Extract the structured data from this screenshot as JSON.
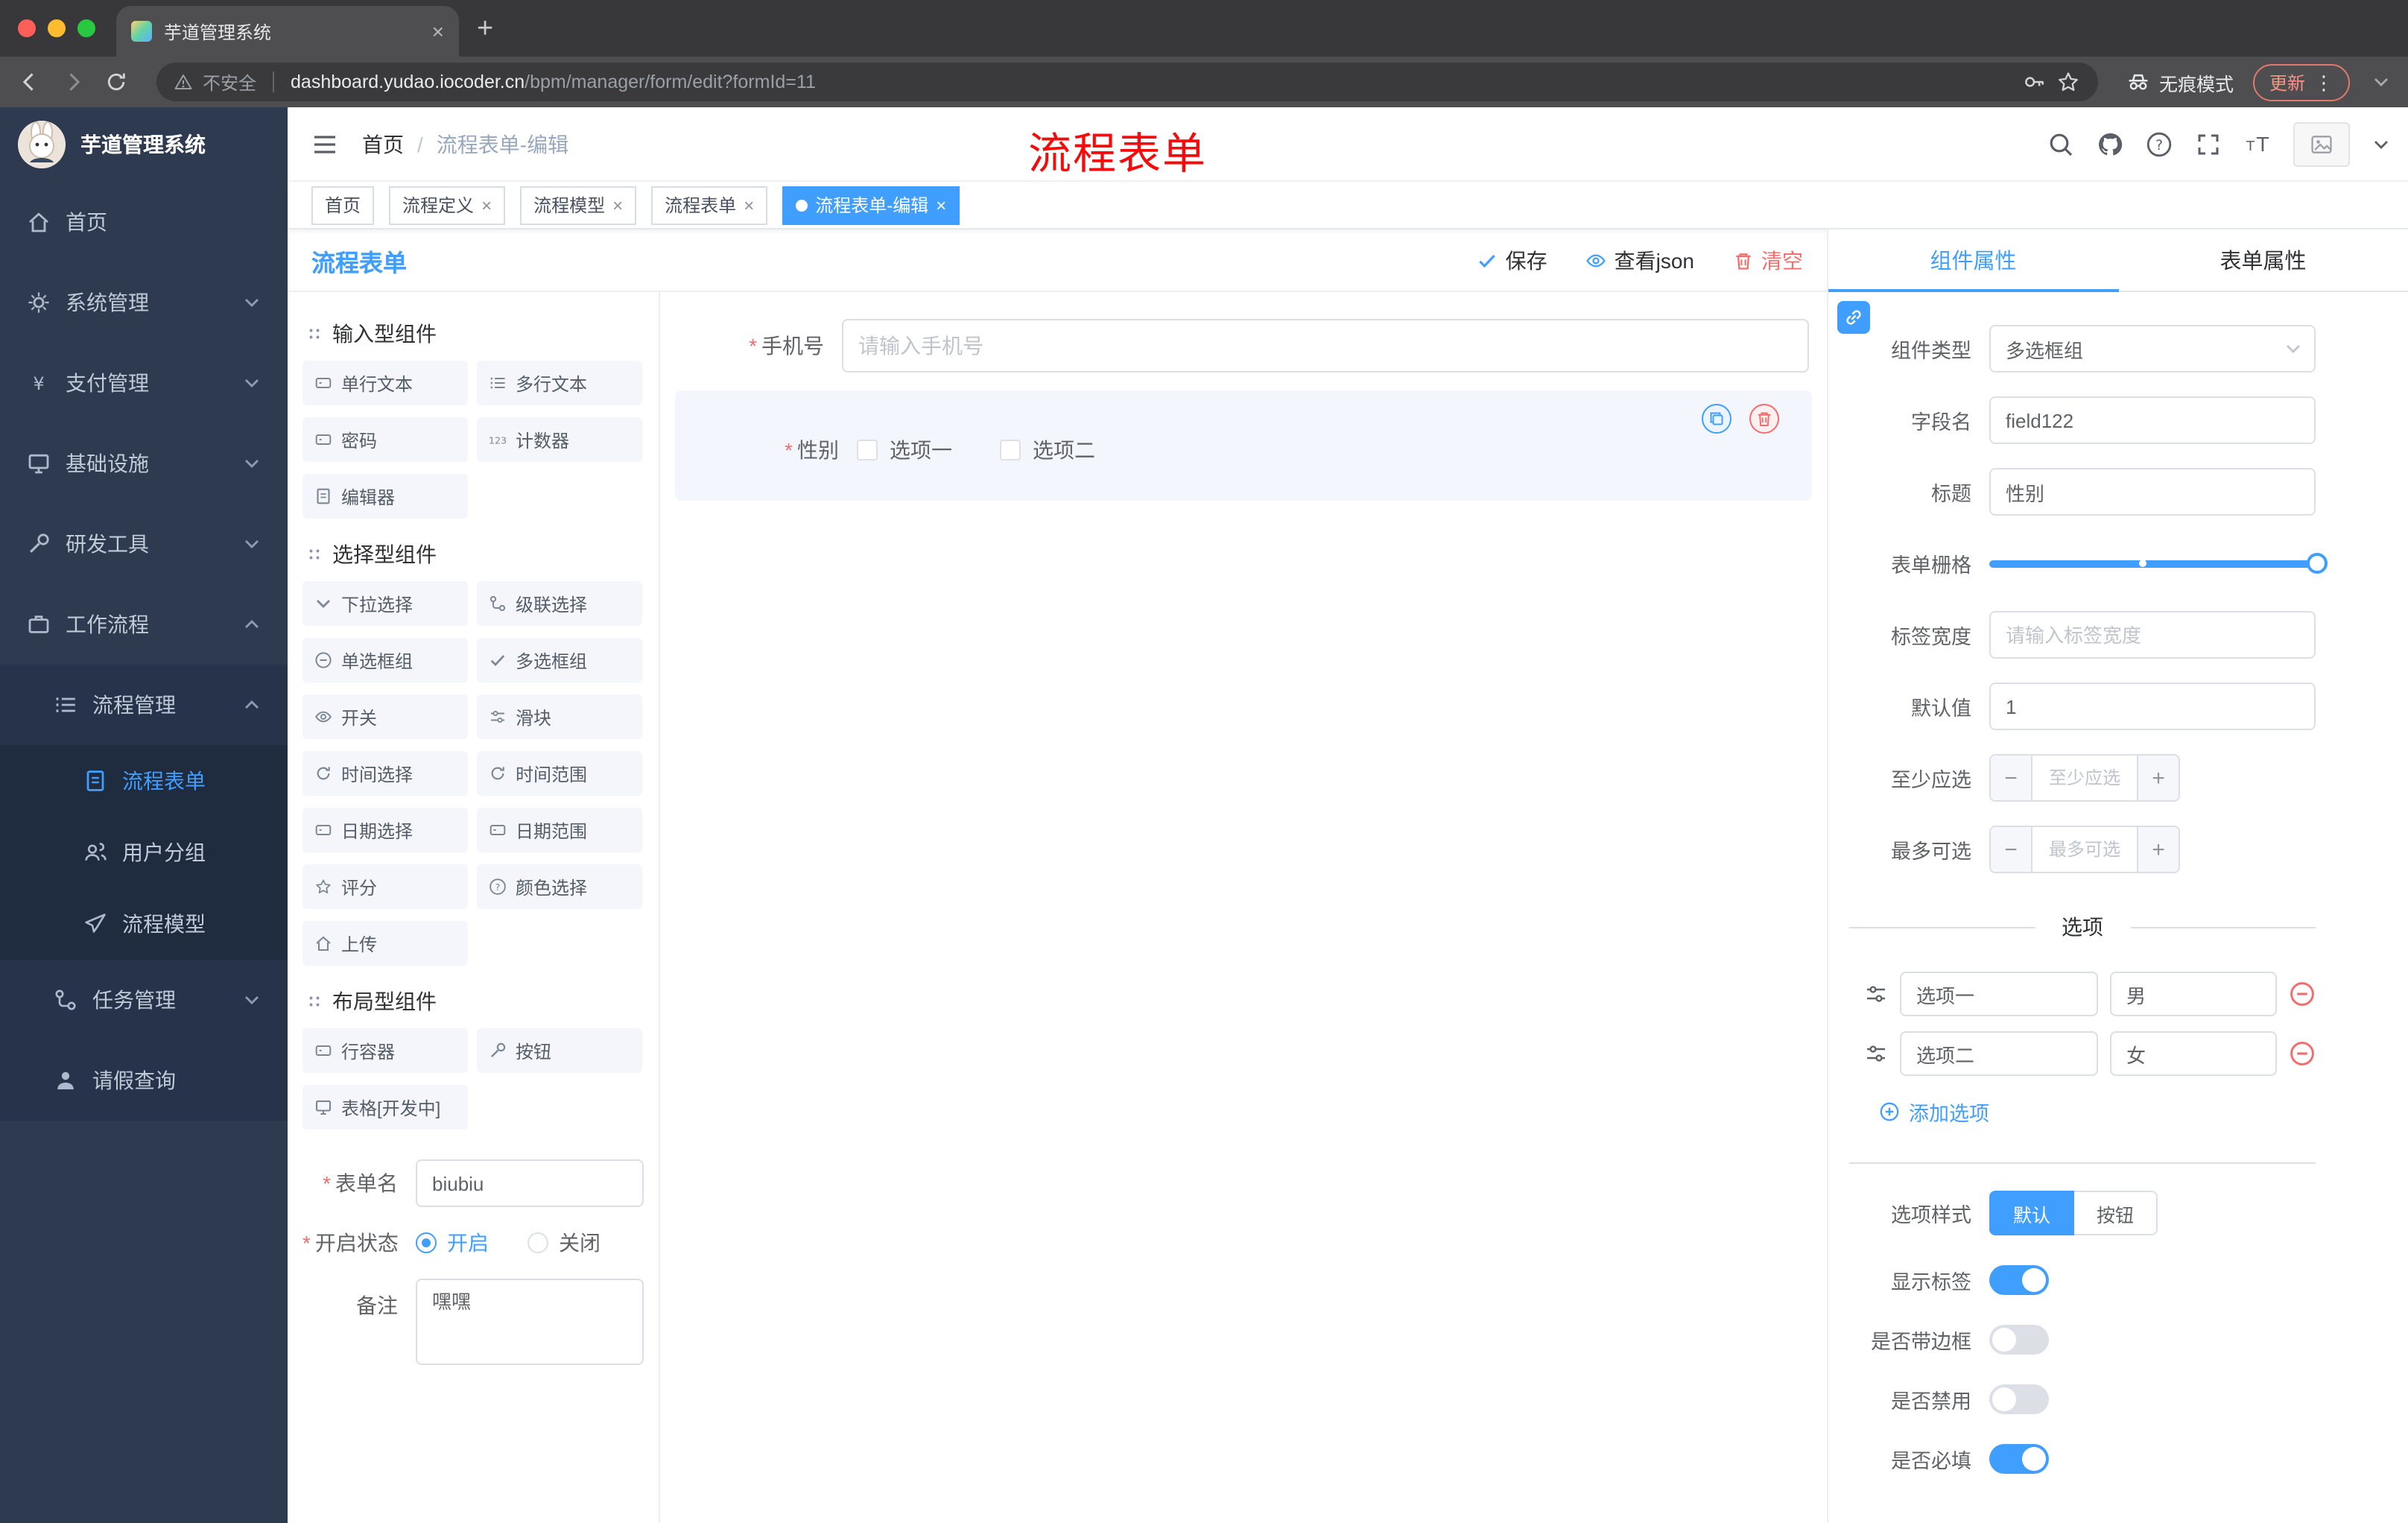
{
  "browser": {
    "tab_title": "芋道管理系统",
    "security_label": "不安全",
    "url_host": "dashboard.yudao.iocoder.cn",
    "url_path": "/bpm/manager/form/edit?formId=11",
    "incognito_label": "无痕模式",
    "update_label": "更新"
  },
  "sidebar": {
    "logo_title": "芋道管理系统",
    "menu": [
      {
        "label": "首页",
        "icon": "home-icon"
      },
      {
        "label": "系统管理",
        "icon": "gear-icon"
      },
      {
        "label": "支付管理",
        "icon": "payment-icon"
      },
      {
        "label": "基础设施",
        "icon": "infrastructure-icon"
      },
      {
        "label": "研发工具",
        "icon": "devtools-icon"
      },
      {
        "label": "工作流程",
        "icon": "workflow-icon"
      }
    ],
    "process_group": {
      "label": "流程管理"
    },
    "process_items": [
      {
        "label": "流程表单",
        "active": true
      },
      {
        "label": "用户分组"
      },
      {
        "label": "流程模型"
      }
    ],
    "task_group": {
      "label": "任务管理"
    },
    "leave_item": {
      "label": "请假查询"
    }
  },
  "header": {
    "breadcrumb_home": "首页",
    "breadcrumb_current": "流程表单-编辑",
    "annotation": "流程表单"
  },
  "tags": [
    {
      "label": "首页",
      "closable": false
    },
    {
      "label": "流程定义",
      "closable": true
    },
    {
      "label": "流程模型",
      "closable": true
    },
    {
      "label": "流程表单",
      "closable": true
    },
    {
      "label": "流程表单-编辑",
      "closable": true,
      "active": true
    }
  ],
  "designer": {
    "title": "流程表单",
    "save_label": "保存",
    "view_json_label": "查看json",
    "clear_label": "清空",
    "palette_sections": [
      {
        "title": "输入型组件",
        "items": [
          "单行文本",
          "多行文本",
          "密码",
          "计数器",
          "编辑器"
        ]
      },
      {
        "title": "选择型组件",
        "items": [
          "下拉选择",
          "级联选择",
          "单选框组",
          "多选框组",
          "开关",
          "滑块",
          "时间选择",
          "时间范围",
          "日期选择",
          "日期范围",
          "评分",
          "颜色选择",
          "上传"
        ]
      },
      {
        "title": "布局型组件",
        "items": [
          "行容器",
          "按钮",
          "表格[开发中]"
        ]
      }
    ],
    "meta": {
      "name_label": "表单名",
      "name_value": "biubiu",
      "status_label": "开启状态",
      "status_on": "开启",
      "status_off": "关闭",
      "remark_label": "备注",
      "remark_value": "嘿嘿"
    },
    "canvas": {
      "phone_label": "手机号",
      "phone_placeholder": "请输入手机号",
      "gender_label": "性别",
      "gender_option1": "选项一",
      "gender_option2": "选项二"
    }
  },
  "props": {
    "tab_component": "组件属性",
    "tab_form": "表单属性",
    "component_type_label": "组件类型",
    "component_type_value": "多选框组",
    "field_name_label": "字段名",
    "field_name_value": "field122",
    "title_label": "标题",
    "title_value": "性别",
    "grid_label": "表单栅格",
    "label_width_label": "标签宽度",
    "label_width_placeholder": "请输入标签宽度",
    "default_label": "默认值",
    "default_value": "1",
    "min_label": "至少应选",
    "min_placeholder": "至少应选",
    "max_label": "最多可选",
    "max_placeholder": "最多可选",
    "options_title": "选项",
    "options": [
      {
        "name": "选项一",
        "value": "男"
      },
      {
        "name": "选项二",
        "value": "女"
      }
    ],
    "add_option_label": "添加选项",
    "style_label": "选项样式",
    "style_default": "默认",
    "style_button": "按钮",
    "show_label_label": "显示标签",
    "show_label_on": true,
    "border_label": "是否带边框",
    "border_on": false,
    "disabled_label": "是否禁用",
    "disabled_on": false,
    "required_label": "是否必填",
    "required_on": true
  },
  "colors": {
    "primary": "#409eff",
    "danger": "#f56c6c",
    "annotation": "#f40b0b"
  }
}
